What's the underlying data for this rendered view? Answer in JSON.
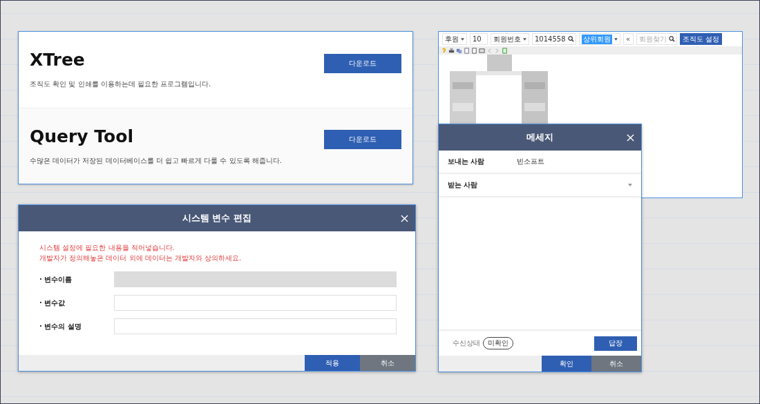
{
  "downloads": [
    {
      "title": "XTree",
      "description": "조직도 확인 및 인쇄를 이용하는데 필요한 프로그램입니다.",
      "button": "다운로드"
    },
    {
      "title": "Query Tool",
      "description": "수많은 데이터가 저장된 데이터베이스를 더 쉽고 빠르게 다룰 수 있도록 해줍니다.",
      "button": "다운로드"
    }
  ],
  "system_variable_dialog": {
    "title": "시스템 변수 편집",
    "notice": [
      "시스템 설정에 필요한 내용을 적어넣습니다.",
      "개발자가 정의해놓은 데이터 외에 데이터는 개발자와 상의하세요."
    ],
    "fields": [
      {
        "label": "· 변수이름",
        "disabled": true
      },
      {
        "label": "· 변수값",
        "disabled": false
      },
      {
        "label": "· 변수의 설명",
        "disabled": false
      }
    ],
    "buttons": [
      {
        "label": "적용",
        "kind": "primary"
      },
      {
        "label": "취소",
        "kind": "secondary"
      }
    ]
  },
  "org_chart_window": {
    "toolbar": [
      {
        "kind": "select",
        "value": "후원",
        "highlighted": false
      },
      {
        "kind": "input",
        "value": "10"
      },
      {
        "kind": "select",
        "value": "회원번호",
        "highlighted": false
      },
      {
        "kind": "search",
        "value": "1014558"
      },
      {
        "kind": "select",
        "value": "상위회원",
        "highlighted": true
      },
      {
        "kind": "button",
        "label": "«"
      },
      {
        "kind": "search",
        "placeholder": "회원찾기"
      },
      {
        "kind": "primary",
        "label": "조직도 설정"
      }
    ]
  },
  "message_dialog": {
    "title": "메세지",
    "sender_label": "보내는 사람",
    "sender": "빈소프트",
    "recipient_label": "받는 사람",
    "status_label": "수신상태",
    "status": "미확인",
    "reply_button": "답장",
    "buttons": [
      {
        "label": "확인",
        "kind": "primary"
      },
      {
        "label": "취소",
        "kind": "secondary"
      }
    ]
  }
}
